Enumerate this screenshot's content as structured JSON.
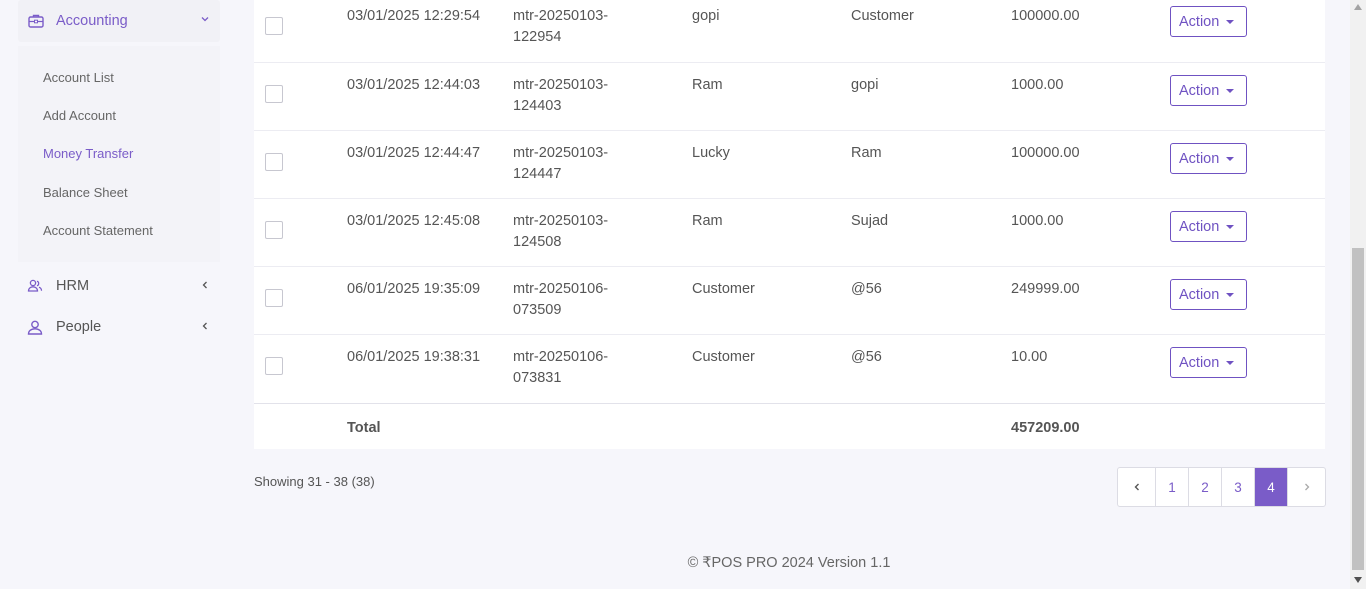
{
  "sidebar": {
    "accounting": {
      "label": "Accounting"
    },
    "submenu": [
      {
        "label": "Account List"
      },
      {
        "label": "Add Account"
      },
      {
        "label": "Money Transfer"
      },
      {
        "label": "Balance Sheet"
      },
      {
        "label": "Account Statement"
      }
    ],
    "hrm": {
      "label": "HRM"
    },
    "people": {
      "label": "People"
    }
  },
  "table": {
    "rows": [
      {
        "datetime": "03/01/2025 12:29:54",
        "ref_line1": "mtr-20250103-",
        "ref_line2": "122954",
        "from": "gopi",
        "to": "Customer",
        "amount": "100000.00",
        "action": "Action"
      },
      {
        "datetime": "03/01/2025 12:44:03",
        "ref_line1": "mtr-20250103-",
        "ref_line2": "124403",
        "from": "Ram",
        "to": "gopi",
        "amount": "1000.00",
        "action": "Action"
      },
      {
        "datetime": "03/01/2025 12:44:47",
        "ref_line1": "mtr-20250103-",
        "ref_line2": "124447",
        "from": "Lucky",
        "to": "Ram",
        "amount": "100000.00",
        "action": "Action"
      },
      {
        "datetime": "03/01/2025 12:45:08",
        "ref_line1": "mtr-20250103-",
        "ref_line2": "124508",
        "from": "Ram",
        "to": "Sujad",
        "amount": "1000.00",
        "action": "Action"
      },
      {
        "datetime": "06/01/2025 19:35:09",
        "ref_line1": "mtr-20250106-",
        "ref_line2": "073509",
        "from": "Customer",
        "to": "@56",
        "amount": "249999.00",
        "action": "Action"
      },
      {
        "datetime": "06/01/2025 19:38:31",
        "ref_line1": "mtr-20250106-",
        "ref_line2": "073831",
        "from": "Customer",
        "to": "@56",
        "amount": "10.00",
        "action": "Action"
      }
    ],
    "total_label": "Total",
    "total_amount": "457209.00"
  },
  "showing": "Showing 31 - 38 (38)",
  "pagination": {
    "pages": [
      "1",
      "2",
      "3",
      "4"
    ],
    "active": "4"
  },
  "footer": {
    "copyright": "© ₹POS PRO 2024 Version 1.1"
  },
  "colors": {
    "accent": "#7a5cc8",
    "button_border": "#6f52c2",
    "background": "#f6f6fb"
  }
}
